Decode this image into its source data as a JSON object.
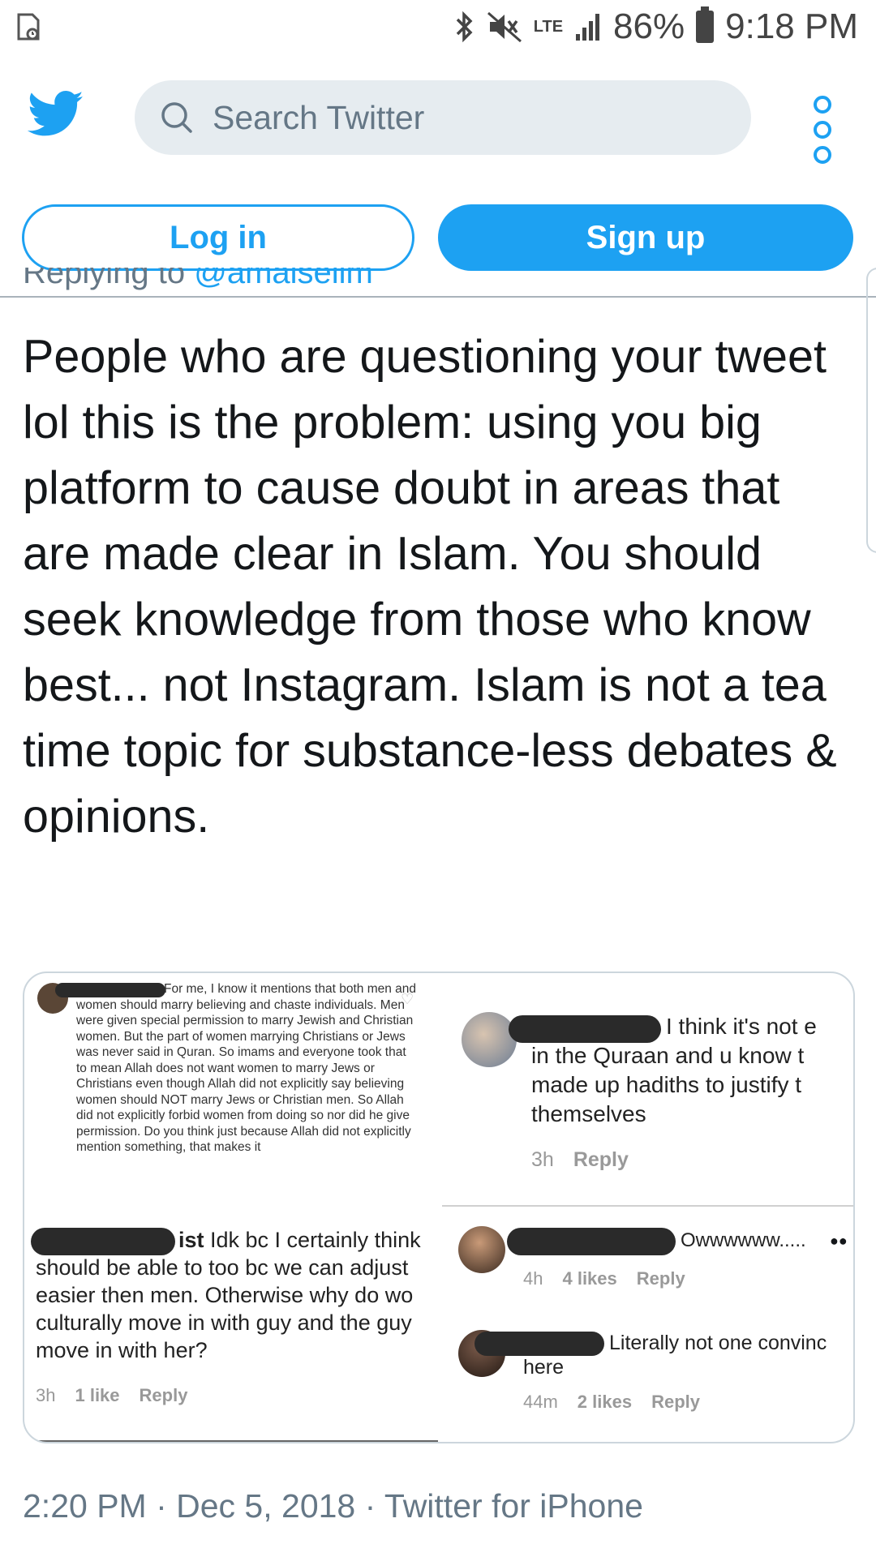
{
  "status_bar": {
    "battery_pct": "86%",
    "time": "9:18 PM",
    "network": "LTE",
    "icons": [
      "sim-icon",
      "bluetooth-icon",
      "mute-icon",
      "signal-icon",
      "battery-icon"
    ]
  },
  "header": {
    "search_placeholder": "Search Twitter",
    "brand_color": "#1da1f2"
  },
  "auth": {
    "login_label": "Log in",
    "signup_label": "Sign up"
  },
  "tweet": {
    "replying_prefix": "Replying to ",
    "replying_handle": "@amaiselim",
    "text": "People who are questioning your tweet lol this is the problem: using you big platform to cause doubt in areas that are made clear in Islam. You should seek knowledge from those who know best... not Instagram. Islam is not a tea time topic for substance-less debates & opinions.",
    "footer": "2:20 PM · Dec 5, 2018 · Twitter for iPhone"
  },
  "media": {
    "comment_1": "For me, I know it mentions that both men and women should marry believing and chaste individuals. Men were given special permission to marry Jewish and Christian women. But the part of women marrying Christians or Jews was never said in Quran. So imams and everyone took that to mean Allah does not want women to marry Jews or Christians even though Allah did not explicitly say believing women should NOT marry Jews or Christian men. So Allah did not explicitly forbid women from doing so nor did he give permission. Do you think just because Allah did not explicitly mention something, that makes it",
    "comment_2": {
      "lines": [
        "I think it's not e",
        "in the Quraan and u know t",
        "made up hadiths to justify t",
        "themselves"
      ],
      "time": "3h",
      "reply": "Reply"
    },
    "comment_3": {
      "suffix": "ist",
      "lines": [
        " Idk bc I certainly think",
        "should be able to too bc we can adjust",
        "easier then men. Otherwise why do wo",
        "culturally move in with guy and the guy",
        "move in with her?"
      ],
      "time": "3h",
      "likes": "1 like",
      "reply": "Reply"
    },
    "comment_4": {
      "text": "Owwwwww.....",
      "time": "4h",
      "likes": "4 likes",
      "reply": "Reply"
    },
    "comment_5": {
      "lines": [
        "Literally not one convinc",
        "here"
      ],
      "time": "44m",
      "likes": "2 likes",
      "reply": "Reply"
    }
  }
}
